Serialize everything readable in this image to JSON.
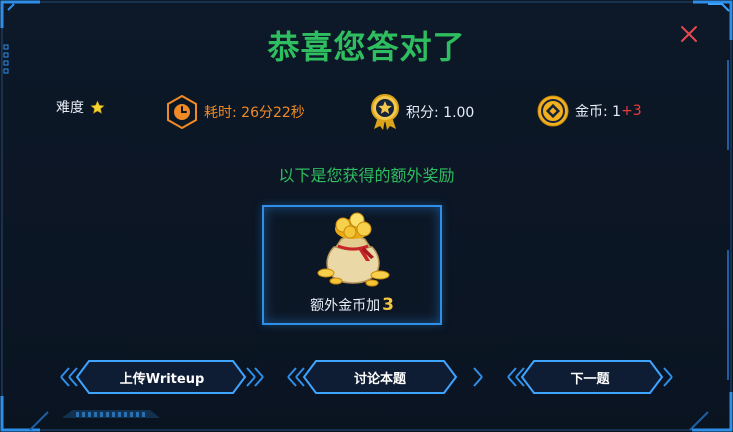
{
  "title": "恭喜您答对了",
  "stats": {
    "difficulty_label": "难度",
    "time_label": "耗时: 26分22秒",
    "score_label": "积分: 1.00",
    "coin_label": "金币: 1",
    "coin_plus": "+3"
  },
  "subtitle": "以下是您获得的额外奖励",
  "reward": {
    "caption": "额外金币加",
    "amount": "3"
  },
  "buttons": {
    "upload": "上传Writeup",
    "discuss": "讨论本题",
    "next": "下一题"
  },
  "colors": {
    "accent_green": "#2ebd5f",
    "time_orange": "#f08a24",
    "close_red": "#e5484d",
    "frame_blue": "#2f8ee8",
    "coin_plus_red": "#ef3b3b"
  },
  "icons": {
    "close": "close-icon",
    "difficulty": "star-icon",
    "time": "clock-icon",
    "score": "medal-icon",
    "coin": "coin-icon",
    "reward": "money-bag-icon"
  }
}
